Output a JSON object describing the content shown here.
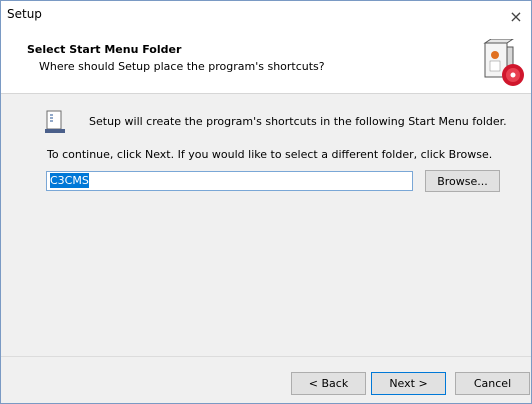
{
  "window": {
    "title": "Setup",
    "close_glyph": "×"
  },
  "header": {
    "title": "Select Start Menu Folder",
    "subtitle": "Where should Setup place the program's shortcuts?",
    "logo_icon": "setup-box-cd-logo"
  },
  "body": {
    "intro": "Setup will create the program's shortcuts in the following Start Menu folder.",
    "hint": "To continue, click Next. If you would like to select a different folder, click Browse.",
    "folder_value": "C3CMS",
    "browse_label": "Browse..."
  },
  "footer": {
    "back_label": "< Back",
    "next_label": "Next >",
    "cancel_label": "Cancel"
  },
  "colors": {
    "accent": "#0078d7",
    "body_bg": "#f0f0f0"
  }
}
